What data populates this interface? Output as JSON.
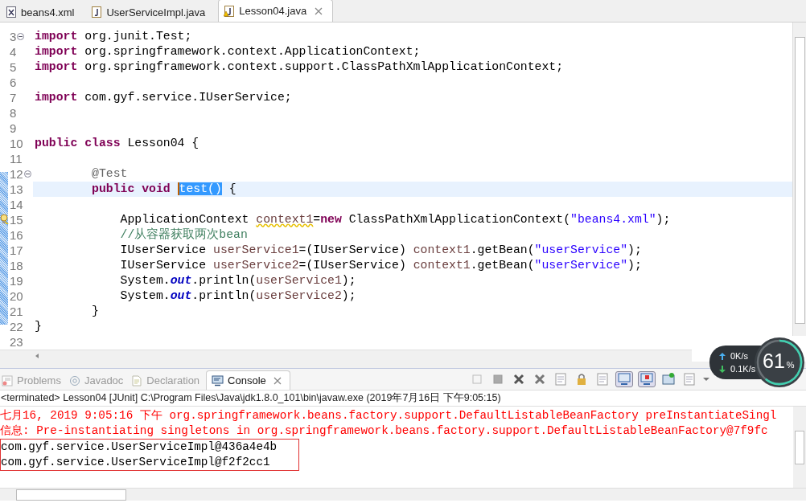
{
  "editor_tabs": [
    {
      "label": "beans4.xml",
      "kind": "xml",
      "selected": false
    },
    {
      "label": "UserServiceImpl.java",
      "kind": "java",
      "selected": false
    },
    {
      "label": "Lesson04.java",
      "kind": "java-warn",
      "selected": true
    }
  ],
  "code_lines": [
    {
      "num": "3",
      "kind": "fold",
      "tokens": [
        {
          "kind": "keyword",
          "t": "import"
        },
        {
          "kind": "plain",
          "t": " org.junit.Test;"
        }
      ]
    },
    {
      "num": "4",
      "kind": "plain",
      "tokens": [
        {
          "kind": "keyword",
          "t": "import"
        },
        {
          "kind": "plain",
          "t": " org.springframework.context.ApplicationContext;"
        }
      ]
    },
    {
      "num": "5",
      "kind": "plain",
      "tokens": [
        {
          "kind": "keyword",
          "t": "import"
        },
        {
          "kind": "plain",
          "t": " org.springframework.context.support.ClassPathXmlApplicationContext;"
        }
      ]
    },
    {
      "num": "6",
      "kind": "plain"
    },
    {
      "num": "7",
      "kind": "plain",
      "tokens": [
        {
          "kind": "keyword",
          "t": "import"
        },
        {
          "kind": "plain",
          "t": " com.gyf.service.IUserService;"
        }
      ]
    },
    {
      "num": "8",
      "kind": "plain"
    },
    {
      "num": "9",
      "kind": "plain"
    },
    {
      "num": "10",
      "kind": "plain",
      "tokens": [
        {
          "kind": "keyword",
          "t": "public class"
        },
        {
          "kind": "plain",
          "t": " Lesson04 {"
        }
      ]
    },
    {
      "num": "11",
      "kind": "plain"
    },
    {
      "num": "12",
      "kind": "fold",
      "tokens": [
        {
          "kind": "annotation",
          "t": "        @Test"
        }
      ]
    },
    {
      "num": "13",
      "kind": "current",
      "tokens": [
        {
          "kind": "keyword",
          "t": "        public void "
        },
        {
          "kind": "selection",
          "t": "test()"
        },
        {
          "kind": "plain",
          "t": " {"
        }
      ]
    },
    {
      "num": "14",
      "kind": "plain"
    },
    {
      "num": "15",
      "kind": "warning",
      "tokens": [
        {
          "kind": "plain",
          "t": "            ApplicationContext "
        },
        {
          "kind": "warned",
          "t": "context1"
        },
        {
          "kind": "plain",
          "t": "="
        },
        {
          "kind": "keyword",
          "t": "new"
        },
        {
          "kind": "plain",
          "t": " ClassPathXmlApplicationContext("
        },
        {
          "kind": "string",
          "t": "\"beans4.xml\""
        },
        {
          "kind": "plain",
          "t": ");"
        }
      ]
    },
    {
      "num": "16",
      "kind": "plain",
      "tokens": [
        {
          "kind": "comment",
          "t": "            //从容器获取两次bean"
        }
      ]
    },
    {
      "num": "17",
      "kind": "plain",
      "tokens": [
        {
          "kind": "plain",
          "t": "            IUserService "
        },
        {
          "kind": "variable",
          "t": "userService1"
        },
        {
          "kind": "plain",
          "t": "=(IUserService) "
        },
        {
          "kind": "variable",
          "t": "context1"
        },
        {
          "kind": "plain",
          "t": ".getBean("
        },
        {
          "kind": "string",
          "t": "\"userService\""
        },
        {
          "kind": "plain",
          "t": ");"
        }
      ]
    },
    {
      "num": "18",
      "kind": "plain",
      "tokens": [
        {
          "kind": "plain",
          "t": "            IUserService "
        },
        {
          "kind": "variable",
          "t": "userService2"
        },
        {
          "kind": "plain",
          "t": "=(IUserService) "
        },
        {
          "kind": "variable",
          "t": "context1"
        },
        {
          "kind": "plain",
          "t": ".getBean("
        },
        {
          "kind": "string",
          "t": "\"userService\""
        },
        {
          "kind": "plain",
          "t": ");"
        }
      ]
    },
    {
      "num": "19",
      "kind": "plain",
      "tokens": [
        {
          "kind": "plain",
          "t": "            System."
        },
        {
          "kind": "field",
          "t": "out"
        },
        {
          "kind": "plain",
          "t": ".println("
        },
        {
          "kind": "variable",
          "t": "userService1"
        },
        {
          "kind": "plain",
          "t": ");"
        }
      ]
    },
    {
      "num": "20",
      "kind": "plain",
      "tokens": [
        {
          "kind": "plain",
          "t": "            System."
        },
        {
          "kind": "field",
          "t": "out"
        },
        {
          "kind": "plain",
          "t": ".println("
        },
        {
          "kind": "variable",
          "t": "userService2"
        },
        {
          "kind": "plain",
          "t": ");"
        }
      ]
    },
    {
      "num": "21",
      "kind": "plain",
      "tokens": [
        {
          "kind": "plain",
          "t": "        }"
        }
      ]
    },
    {
      "num": "22",
      "kind": "plain",
      "tokens": [
        {
          "kind": "plain",
          "t": "}"
        }
      ]
    },
    {
      "num": "23",
      "kind": "plain"
    }
  ],
  "panel_tabs": [
    {
      "label": "Problems",
      "kind": "problems",
      "selected": false
    },
    {
      "label": "Javadoc",
      "kind": "javadoc",
      "selected": false
    },
    {
      "label": "Declaration",
      "kind": "declaration",
      "selected": false
    },
    {
      "label": "Console",
      "kind": "console",
      "selected": true
    }
  ],
  "console": {
    "status": "<terminated> Lesson04 [JUnit] C:\\Program Files\\Java\\jdk1.8.0_101\\bin\\javaw.exe (2019年7月16日 下午9:05:15)",
    "log_lines": [
      "七月16, 2019 9:05:16 下午 org.springframework.beans.factory.support.DefaultListableBeanFactory preInstantiateSingl",
      "信息: Pre-instantiating singletons in org.springframework.beans.factory.support.DefaultListableBeanFactory@7f9fc"
    ],
    "output_lines": [
      "com.gyf.service.UserServiceImpl@436a4e4b",
      "com.gyf.service.UserServiceImpl@f2f2cc1"
    ]
  },
  "net_widget": {
    "upload": "0K/s",
    "download": "0.1K/s",
    "percent": "61",
    "percent_unit": "%"
  }
}
